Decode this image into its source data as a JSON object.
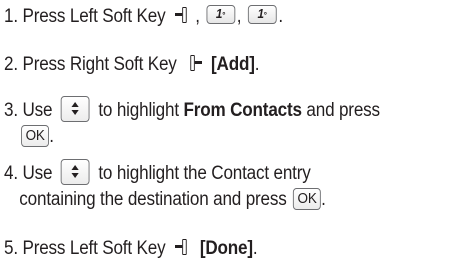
{
  "steps": [
    {
      "num": "1.",
      "text": "Press Left Soft Key",
      "key_label": "1",
      "separator": ",",
      "end": "."
    },
    {
      "num": "2.",
      "text": "Press Right Soft Key",
      "bold": "[Add]",
      "end": "."
    },
    {
      "num": "3.",
      "text_before": "Use",
      "text_after": "to highlight",
      "bold": "From Contacts",
      "text_end": "and press",
      "ok": "OK",
      "end": "."
    },
    {
      "num": "4.",
      "text_before": "Use",
      "text_after": "to highlight the Contact entry",
      "line2": "containing the destination and press",
      "ok": "OK",
      "end": "."
    },
    {
      "num": "5.",
      "text": "Press Left Soft Key",
      "bold": "[Done]",
      "end": "."
    }
  ],
  "icons": {
    "left_soft_key": "left-soft-key-icon",
    "right_soft_key": "right-soft-key-icon",
    "key_1": "key-1-icon",
    "navigation_key": "navigation-key-icon",
    "ok_key": "ok-key-icon"
  }
}
